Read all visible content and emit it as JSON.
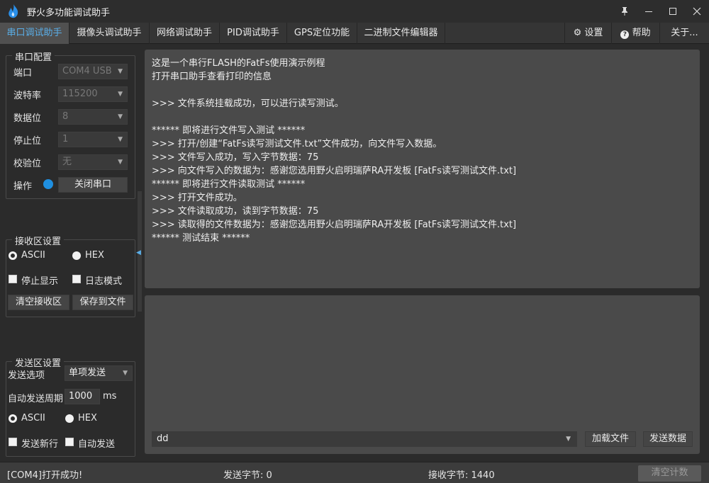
{
  "app": {
    "title": "野火多功能调试助手"
  },
  "window_buttons": {
    "pin": "📌",
    "minimize": "—",
    "maximize": "☐",
    "close": "✕"
  },
  "tabs": [
    {
      "label": "串口调试助手",
      "active": true
    },
    {
      "label": "摄像头调试助手"
    },
    {
      "label": "网络调试助手"
    },
    {
      "label": "PID调试助手"
    },
    {
      "label": "GPS定位功能"
    },
    {
      "label": "二进制文件编辑器"
    }
  ],
  "right_tabs": {
    "settings": "设置",
    "help": "帮助",
    "about": "关于..."
  },
  "serial_config": {
    "title": "串口配置",
    "port_label": "端口",
    "port_value": "COM4 USB",
    "baud_label": "波特率",
    "baud_value": "115200",
    "databits_label": "数据位",
    "databits_value": "8",
    "stopbits_label": "停止位",
    "stopbits_value": "1",
    "parity_label": "校验位",
    "parity_value": "无",
    "op_label": "操作",
    "close_button": "关闭串口"
  },
  "receive_settings": {
    "title": "接收区设置",
    "ascii": "ASCII",
    "hex": "HEX",
    "stop_display": "停止显示",
    "log_mode": "日志模式",
    "clear_button": "清空接收区",
    "save_button": "保存到文件"
  },
  "send_settings": {
    "title": "发送区设置",
    "option_label": "发送选项",
    "option_value": "单项发送",
    "period_label": "自动发送周期",
    "period_value": "1000",
    "period_unit": "ms",
    "ascii": "ASCII",
    "hex": "HEX",
    "newline": "发送新行",
    "auto_send": "自动发送"
  },
  "receive_text": [
    "这是一个串行FLASH的FatFs使用演示例程",
    "打开串口助手查看打印的信息",
    "",
    ">>> 文件系统挂载成功，可以进行读写测试。",
    "",
    "****** 即将进行文件写入测试 ******",
    ">>> 打开/创建“FatFs读写测试文件.txt”文件成功，向文件写入数据。",
    ">>> 文件写入成功，写入字节数据：75",
    ">>> 向文件写入的数据为：感谢您选用野火启明瑞萨RA开发板 [FatFs读写测试文件.txt]",
    "****** 即将进行文件读取测试 ******",
    ">>> 打开文件成功。",
    ">>> 文件读取成功，读到字节数据：75",
    ">>> 读取得的文件数据为：感谢您选用野火启明瑞萨RA开发板 [FatFs读写测试文件.txt]",
    "****** 测试结束 ******"
  ],
  "send_area": {
    "input_value": "dd",
    "load_file": "加载文件",
    "send_data": "发送数据"
  },
  "status": {
    "message": "[COM4]打开成功!",
    "sent_bytes": "发送字节: 0",
    "recv_bytes": "接收字节: 1440",
    "clear_count": "清空计数"
  },
  "colors": {
    "accent": "#5aaee8",
    "status_dot": "#1f8fe0"
  }
}
